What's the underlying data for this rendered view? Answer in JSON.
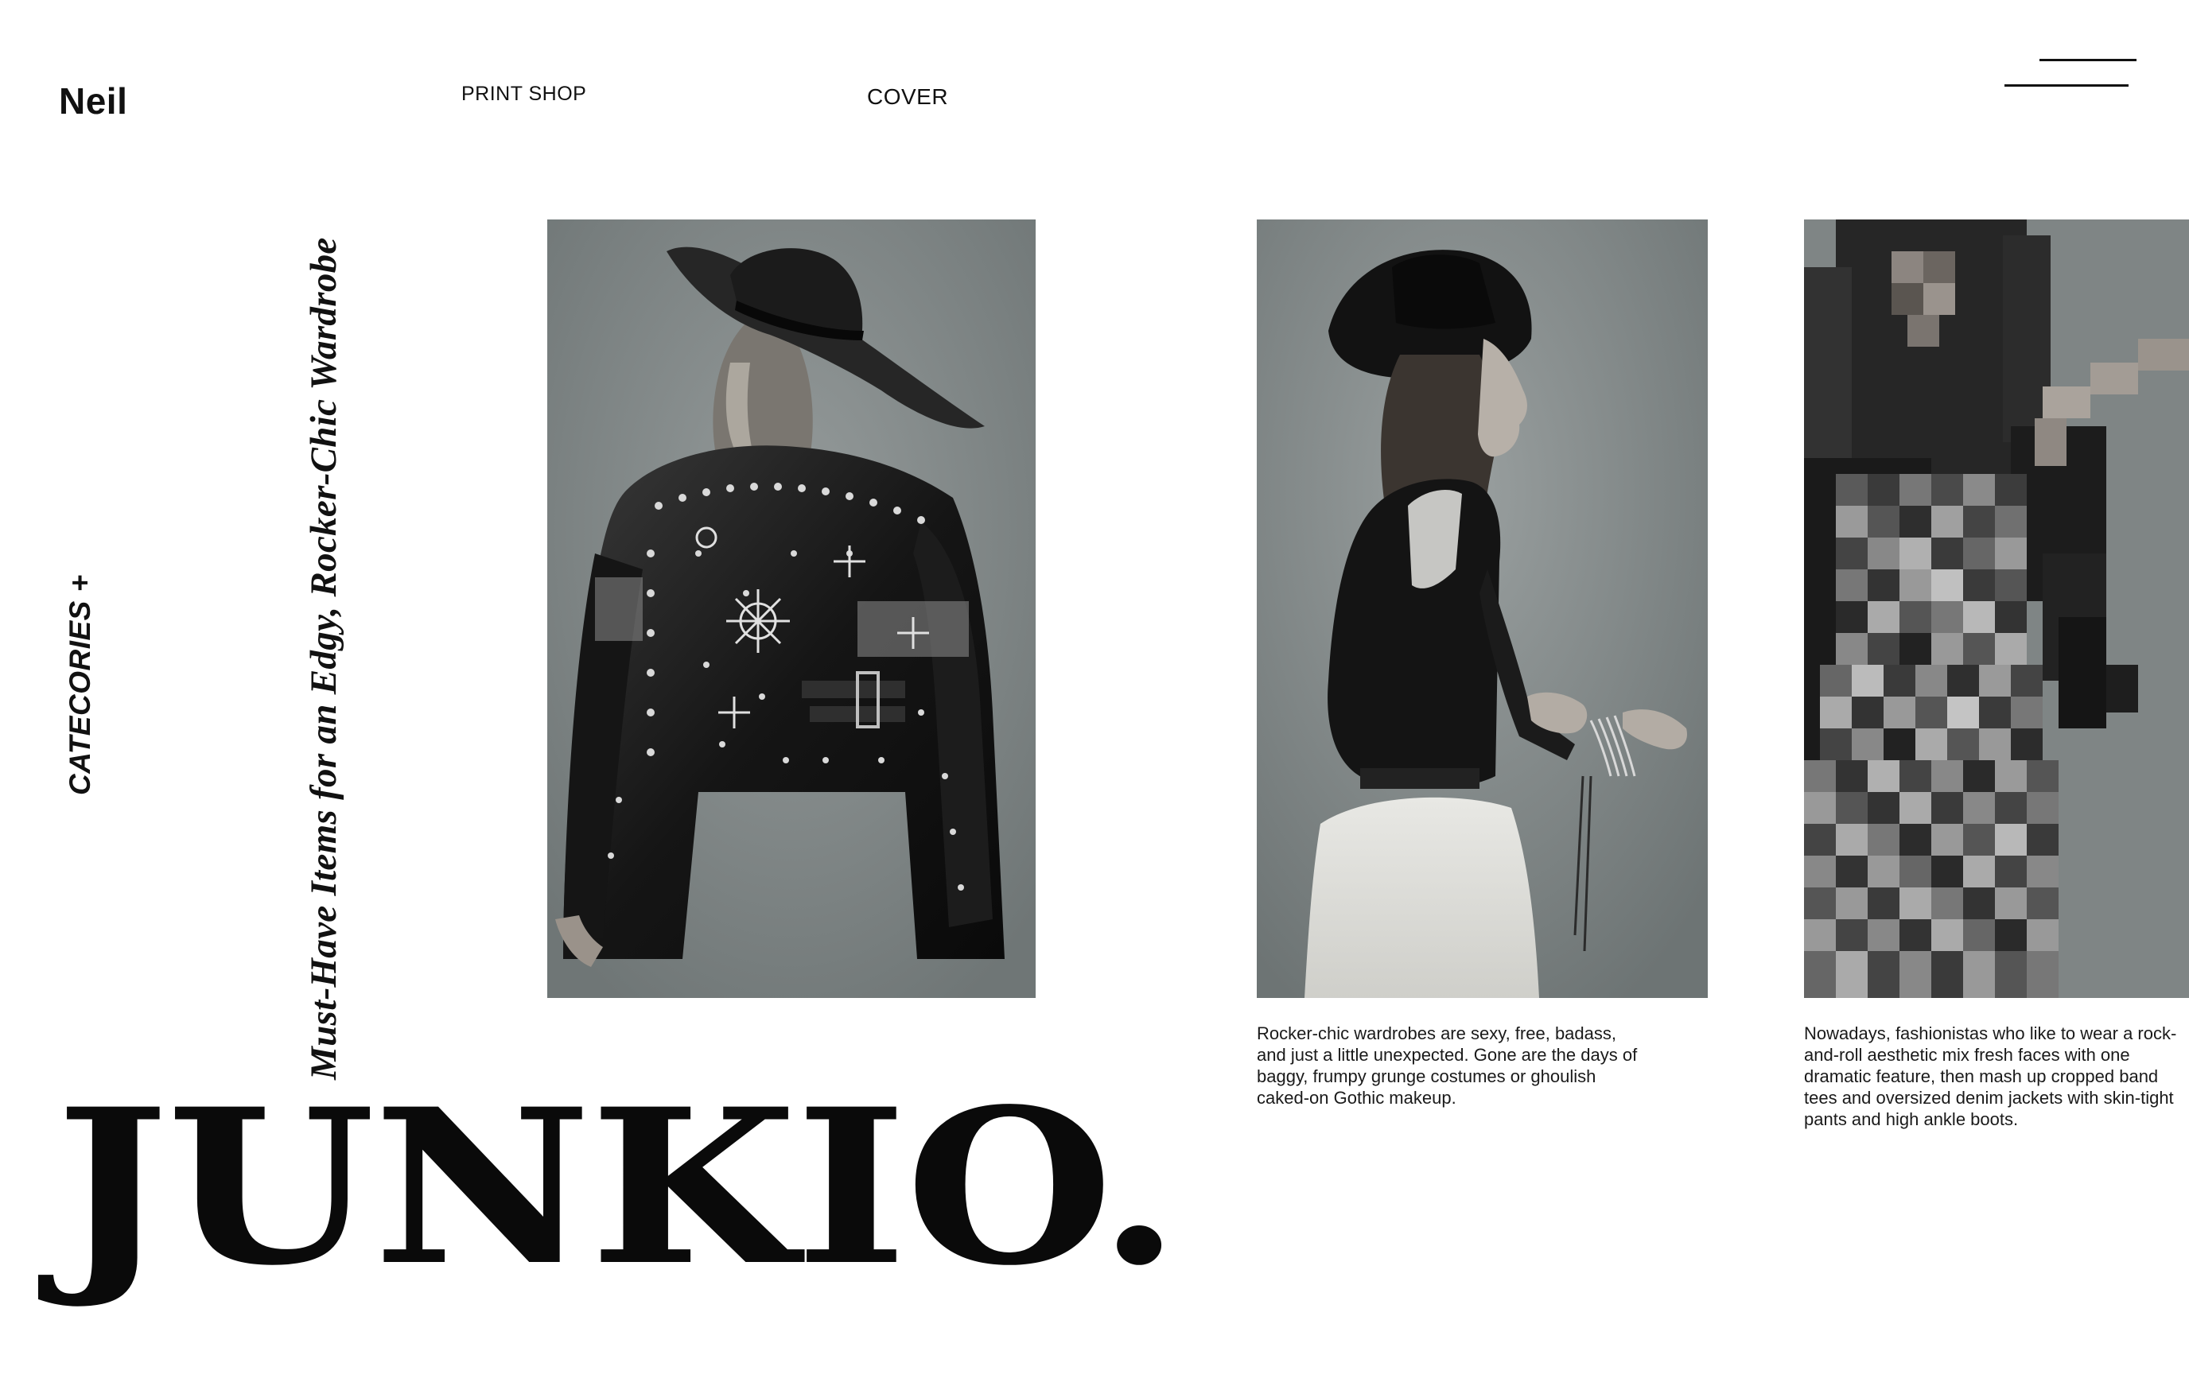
{
  "header": {
    "brand": "Neil",
    "nav": {
      "print_shop": "PRINT SHOP",
      "cover": "COVER"
    },
    "menu_icon": "hamburger-menu-icon"
  },
  "sidebar": {
    "categories_label": "CATECORIES +"
  },
  "feature": {
    "headline": "Must-Have Items for an Edgy, Rocker-Chic Wardrobe",
    "logo": "JUNKIO."
  },
  "gallery": {
    "photos": [
      {
        "subject": "woman in hat and studded leather jacket, back view",
        "caption": ""
      },
      {
        "subject": "woman in wide-brim hat, leather jacket and white dress, side profile",
        "caption": "Rocker-chic wardrobes are sexy, free, badass, and just a little unexpected. Gone are the days of baggy, frumpy grunge costumes or ghoulish caked-on Gothic makeup."
      },
      {
        "subject": "pixelated woman in sequined dress",
        "caption": "Nowadays, fashionistas who like to wear a rock-and-roll aesthetic mix fresh faces with one dramatic feature, then mash up cropped band tees and oversized denim jackets with skin-tight pants and high ankle boots."
      }
    ]
  },
  "colors": {
    "text": "#111111",
    "background": "#ffffff",
    "photo_backdrop": "#7f8686"
  }
}
